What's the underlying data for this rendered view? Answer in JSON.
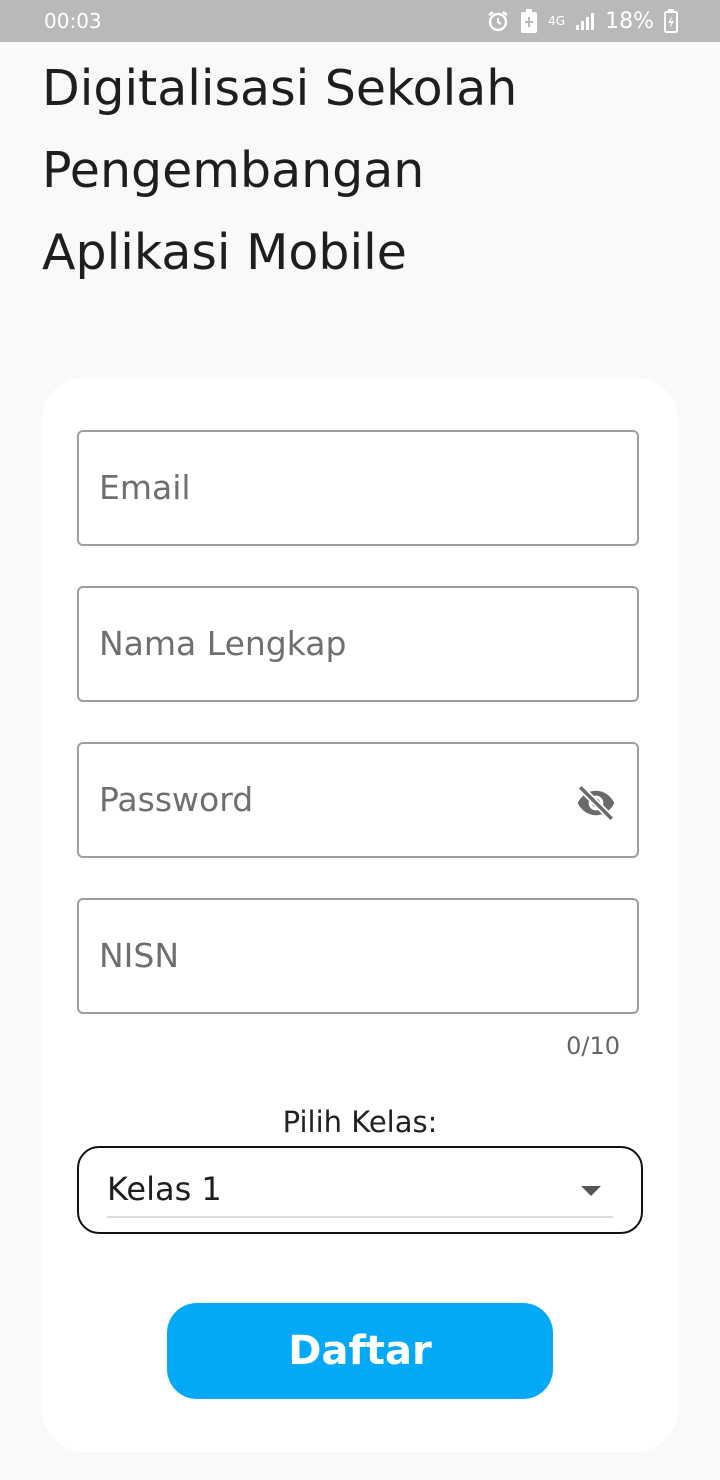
{
  "status_bar": {
    "time": "00:03",
    "network": "4G",
    "battery": "18%"
  },
  "title_lines": [
    "Digitalisasi Sekolah",
    "Pengembangan",
    "Aplikasi Mobile"
  ],
  "form": {
    "email": {
      "placeholder": "Email"
    },
    "full_name": {
      "placeholder": "Nama Lengkap"
    },
    "password": {
      "placeholder": "Password"
    },
    "nisn": {
      "placeholder": "NISN",
      "counter": "0/10"
    },
    "class_label": "Pilih Kelas:",
    "class_selected": "Kelas 1",
    "submit_label": "Daftar"
  },
  "colors": {
    "accent": "#03a9f4",
    "status_bar": "#b9b9b9",
    "background": "#f9f9f9"
  },
  "icons": [
    "alarm-icon",
    "battery-saver-icon",
    "signal-icon",
    "battery-charging-icon",
    "visibility-off-icon",
    "dropdown-caret-icon"
  ]
}
